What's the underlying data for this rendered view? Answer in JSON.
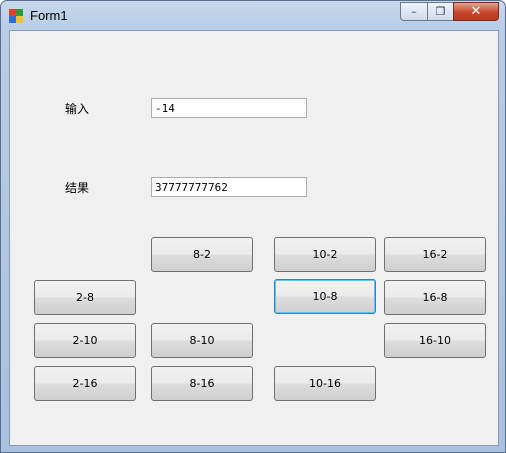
{
  "window": {
    "title": "Form1"
  },
  "caption": {
    "minimize": "–",
    "maximize": "❐",
    "close": "✕"
  },
  "form": {
    "input_label": "输入",
    "input_value": "-14",
    "result_label": "结果",
    "result_value": "37777777762"
  },
  "buttons": {
    "b8_2": "8-2",
    "b10_2": "10-2",
    "b16_2": "16-2",
    "b2_8": "2-8",
    "b10_8": "10-8",
    "b16_8": "16-8",
    "b2_10": "2-10",
    "b8_10": "8-10",
    "b16_10": "16-10",
    "b2_16": "2-16",
    "b8_16": "8-16",
    "b10_16": "10-16"
  }
}
